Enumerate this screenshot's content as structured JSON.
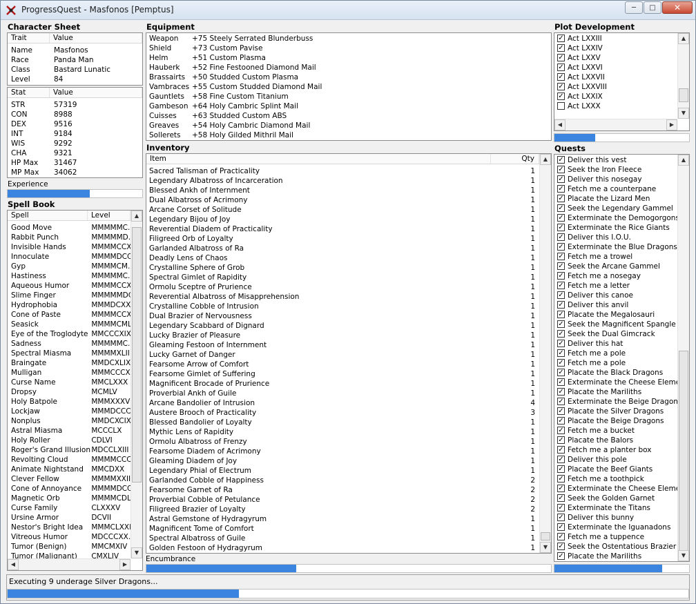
{
  "window": {
    "title": "ProgressQuest - Masfonos [Pemptus]"
  },
  "character_sheet": {
    "header": "Character Sheet",
    "traits_columns": [
      "Trait",
      "Value"
    ],
    "traits": [
      {
        "k": "Name",
        "v": "Masfonos"
      },
      {
        "k": "Race",
        "v": "Panda Man"
      },
      {
        "k": "Class",
        "v": "Bastard Lunatic"
      },
      {
        "k": "Level",
        "v": "84"
      }
    ],
    "stats_columns": [
      "Stat",
      "Value"
    ],
    "stats": [
      {
        "k": "STR",
        "v": "57319"
      },
      {
        "k": "CON",
        "v": "8988"
      },
      {
        "k": "DEX",
        "v": "9516"
      },
      {
        "k": "INT",
        "v": "9184"
      },
      {
        "k": "WIS",
        "v": "9292"
      },
      {
        "k": "CHA",
        "v": "9321"
      },
      {
        "k": "HP Max",
        "v": "31467"
      },
      {
        "k": "MP Max",
        "v": "34062"
      }
    ],
    "experience_label": "Experience",
    "experience_progress": 0.61
  },
  "spell_book": {
    "header": "Spell Book",
    "columns": [
      "Spell",
      "Level"
    ],
    "spells": [
      {
        "name": "Good Move",
        "level": "MMMMMC."
      },
      {
        "name": "Rabbit Punch",
        "level": "MMMMMD."
      },
      {
        "name": "Invisible Hands",
        "level": "MMMMCCX"
      },
      {
        "name": "Innoculate",
        "level": "MMMMDCCI"
      },
      {
        "name": "Gyp",
        "level": "MMMMCM."
      },
      {
        "name": "Hastiness",
        "level": "MMMMMC."
      },
      {
        "name": "Aqueous Humor",
        "level": "MMMMCCX"
      },
      {
        "name": "Slime Finger",
        "level": "MMMMMDC"
      },
      {
        "name": "Hydrophobia",
        "level": "MMMDCXX"
      },
      {
        "name": "Cone of Paste",
        "level": "MMMMCCX"
      },
      {
        "name": "Seasick",
        "level": "MMMMCML"
      },
      {
        "name": "Eye of the Troglodyte",
        "level": "MMCCCXIX"
      },
      {
        "name": "Sadness",
        "level": "MMMMMC."
      },
      {
        "name": "Spectral Miasma",
        "level": "MMMMXLII"
      },
      {
        "name": "Braingate",
        "level": "MMDCXLIX"
      },
      {
        "name": "Mulligan",
        "level": "MMMCCCX"
      },
      {
        "name": "Curse Name",
        "level": "MMCLXXX"
      },
      {
        "name": "Dropsy",
        "level": "MCMLV"
      },
      {
        "name": "Holy Batpole",
        "level": "MMMXXXV"
      },
      {
        "name": "Lockjaw",
        "level": "MMMDCCC"
      },
      {
        "name": "Nonplus",
        "level": "MMDCXCIX"
      },
      {
        "name": "Astral Miasma",
        "level": "MCCCLX"
      },
      {
        "name": "Holy Roller",
        "level": "CDLVI"
      },
      {
        "name": "Roger's Grand Illusion",
        "level": "MDCCLXIII"
      },
      {
        "name": "Revolting Cloud",
        "level": "MMMMCCC"
      },
      {
        "name": "Animate Nightstand",
        "level": "MMCDXX"
      },
      {
        "name": "Clever Fellow",
        "level": "MMMMXXII"
      },
      {
        "name": "Cone of Annoyance",
        "level": "MMMMDCC"
      },
      {
        "name": "Magnetic Orb",
        "level": "MMMMCDL"
      },
      {
        "name": "Curse Family",
        "level": "CLXXXV"
      },
      {
        "name": "Ursine Armor",
        "level": "DCVII"
      },
      {
        "name": "Nestor's Bright Idea",
        "level": "MMMCLXXI"
      },
      {
        "name": "Vitreous Humor",
        "level": "MDCCCXX."
      },
      {
        "name": "Tumor (Benign)",
        "level": "MMCMXIV"
      },
      {
        "name": "Tumor (Malignant)",
        "level": "CMXLIV"
      }
    ]
  },
  "equipment": {
    "header": "Equipment",
    "items": [
      {
        "slot": "Weapon",
        "item": "+75 Steely Serrated Blunderbuss"
      },
      {
        "slot": "Shield",
        "item": "+73 Custom Pavise"
      },
      {
        "slot": "Helm",
        "item": "+51 Custom Plasma"
      },
      {
        "slot": "Hauberk",
        "item": "+52 Fine Festooned Diamond Mail"
      },
      {
        "slot": "Brassairts",
        "item": "+50 Studded Custom Plasma"
      },
      {
        "slot": "Vambraces",
        "item": "+55 Custom Studded Diamond Mail"
      },
      {
        "slot": "Gauntlets",
        "item": "+58 Fine Custom Titanium"
      },
      {
        "slot": "Gambeson",
        "item": "+64 Holy Cambric Splint Mail"
      },
      {
        "slot": "Cuisses",
        "item": "+63 Studded Custom ABS"
      },
      {
        "slot": "Greaves",
        "item": "+54 Holy Cambric Diamond Mail"
      },
      {
        "slot": "Sollerets",
        "item": "+58 Holy Gilded Mithril Mail"
      }
    ]
  },
  "inventory": {
    "header": "Inventory",
    "columns": [
      "Item",
      "Qty"
    ],
    "items": [
      {
        "name": "Sacred Talisman of Practicality",
        "qty": "1"
      },
      {
        "name": "Legendary Albatross of Incarceration",
        "qty": "1"
      },
      {
        "name": "Blessed Ankh of Internment",
        "qty": "1"
      },
      {
        "name": "Dual Albatross of Acrimony",
        "qty": "1"
      },
      {
        "name": "Arcane Corset of Solitude",
        "qty": "1"
      },
      {
        "name": "Legendary Bijou of Joy",
        "qty": "1"
      },
      {
        "name": "Reverential Diadem of Practicality",
        "qty": "1"
      },
      {
        "name": "Filigreed Orb of Loyalty",
        "qty": "1"
      },
      {
        "name": "Garlanded Albatross of Ra",
        "qty": "1"
      },
      {
        "name": "Deadly Lens of Chaos",
        "qty": "1"
      },
      {
        "name": "Crystalline Sphere of Grob",
        "qty": "1"
      },
      {
        "name": "Spectral Gimlet of Rapidity",
        "qty": "1"
      },
      {
        "name": "Ormolu Sceptre of Prurience",
        "qty": "1"
      },
      {
        "name": "Reverential Albatross of Misapprehension",
        "qty": "1"
      },
      {
        "name": "Crystalline Cobble of Intrusion",
        "qty": "1"
      },
      {
        "name": "Dual Brazier of Nervousness",
        "qty": "1"
      },
      {
        "name": "Legendary Scabbard of Dignard",
        "qty": "1"
      },
      {
        "name": "Lucky Brazier of Pleasure",
        "qty": "1"
      },
      {
        "name": "Gleaming Festoon of Internment",
        "qty": "1"
      },
      {
        "name": "Lucky Garnet of Danger",
        "qty": "1"
      },
      {
        "name": "Fearsome Arrow of Comfort",
        "qty": "1"
      },
      {
        "name": "Fearsome Gimlet of Suffering",
        "qty": "1"
      },
      {
        "name": "Magnificent Brocade of Prurience",
        "qty": "1"
      },
      {
        "name": "Proverbial Ankh of Guile",
        "qty": "1"
      },
      {
        "name": "Arcane Bandolier of Intrusion",
        "qty": "4"
      },
      {
        "name": "Austere Brooch of Practicality",
        "qty": "3"
      },
      {
        "name": "Blessed Bandolier of Loyalty",
        "qty": "1"
      },
      {
        "name": "Mythic Lens of Rapidity",
        "qty": "1"
      },
      {
        "name": "Ormolu Albatross of Frenzy",
        "qty": "1"
      },
      {
        "name": "Fearsome Diadem of Acrimony",
        "qty": "1"
      },
      {
        "name": "Gleaming Diadem of Joy",
        "qty": "1"
      },
      {
        "name": "Legendary Phial of Electrum",
        "qty": "1"
      },
      {
        "name": "Garlanded Cobble of Happiness",
        "qty": "2"
      },
      {
        "name": "Fearsome Garnet of Ra",
        "qty": "2"
      },
      {
        "name": "Proverbial Cobble of Petulance",
        "qty": "2"
      },
      {
        "name": "Filigreed Brazier of Loyalty",
        "qty": "2"
      },
      {
        "name": "Astral Gemstone of Hydragyrum",
        "qty": "1"
      },
      {
        "name": "Magnificent Tome of Comfort",
        "qty": "1"
      },
      {
        "name": "Spectral Albatross of Guile",
        "qty": "1"
      },
      {
        "name": "Golden Festoon of Hydragyrum",
        "qty": "1"
      }
    ],
    "encumbrance_label": "Encumbrance",
    "encumbrance_progress": 0.37
  },
  "plot": {
    "header": "Plot Development",
    "acts": [
      {
        "label": "Act LXXIII",
        "done": true
      },
      {
        "label": "Act LXXIV",
        "done": true
      },
      {
        "label": "Act LXXV",
        "done": true
      },
      {
        "label": "Act LXXVI",
        "done": true
      },
      {
        "label": "Act LXXVII",
        "done": true
      },
      {
        "label": "Act LXXVIII",
        "done": true
      },
      {
        "label": "Act LXXIX",
        "done": true
      },
      {
        "label": "Act LXXX",
        "done": false
      }
    ],
    "progress": 0.3
  },
  "quests": {
    "header": "Quests",
    "items": [
      {
        "label": "Deliver this vest",
        "done": true
      },
      {
        "label": "Seek the Iron Fleece",
        "done": true
      },
      {
        "label": "Deliver this nosegay",
        "done": true
      },
      {
        "label": "Fetch me a counterpane",
        "done": true
      },
      {
        "label": "Placate the Lizard Men",
        "done": true
      },
      {
        "label": "Seek the Legendary Gammel",
        "done": true
      },
      {
        "label": "Exterminate the Demogorgons",
        "done": true
      },
      {
        "label": "Exterminate the Rice Giants",
        "done": true
      },
      {
        "label": "Deliver this I.O.U.",
        "done": true
      },
      {
        "label": "Exterminate the Blue Dragons",
        "done": true
      },
      {
        "label": "Fetch me a trowel",
        "done": true
      },
      {
        "label": "Seek the Arcane Gammel",
        "done": true
      },
      {
        "label": "Fetch me a nosegay",
        "done": true
      },
      {
        "label": "Fetch me a letter",
        "done": true
      },
      {
        "label": "Deliver this canoe",
        "done": true
      },
      {
        "label": "Deliver this anvil",
        "done": true
      },
      {
        "label": "Placate the Megalosauri",
        "done": true
      },
      {
        "label": "Seek the Magnificent Spangle",
        "done": true
      },
      {
        "label": "Seek the Dual Gimcrack",
        "done": true
      },
      {
        "label": "Deliver this hat",
        "done": true
      },
      {
        "label": "Fetch me a pole",
        "done": true
      },
      {
        "label": "Fetch me a pole",
        "done": true
      },
      {
        "label": "Placate the Black Dragons",
        "done": true
      },
      {
        "label": "Exterminate the Cheese Elemen...",
        "done": true
      },
      {
        "label": "Placate the Mariliths",
        "done": true
      },
      {
        "label": "Exterminate the Beige Dragons",
        "done": true
      },
      {
        "label": "Placate the Silver Dragons",
        "done": true
      },
      {
        "label": "Placate the Beige Dragons",
        "done": true
      },
      {
        "label": "Fetch me a bucket",
        "done": true
      },
      {
        "label": "Placate the Balors",
        "done": true
      },
      {
        "label": "Fetch me a planter box",
        "done": true
      },
      {
        "label": "Deliver this pole",
        "done": true
      },
      {
        "label": "Placate the Beef Giants",
        "done": true
      },
      {
        "label": "Fetch me a toothpick",
        "done": true
      },
      {
        "label": "Exterminate the Cheese Elemen...",
        "done": true
      },
      {
        "label": "Seek the Golden Garnet",
        "done": true
      },
      {
        "label": "Exterminate the Titans",
        "done": true
      },
      {
        "label": "Deliver this bunny",
        "done": true
      },
      {
        "label": "Exterminate the Iguanadons",
        "done": true
      },
      {
        "label": "Fetch me a tuppence",
        "done": true
      },
      {
        "label": "Seek the Ostentatious Brazier",
        "done": true
      },
      {
        "label": "Placate the Mariliths",
        "done": true
      }
    ],
    "progress": 0.8
  },
  "status": {
    "text": "Executing 9 underage Silver Dragons...",
    "progress": 0.34
  },
  "colors": {
    "progress_fill": "#3b84e0"
  }
}
